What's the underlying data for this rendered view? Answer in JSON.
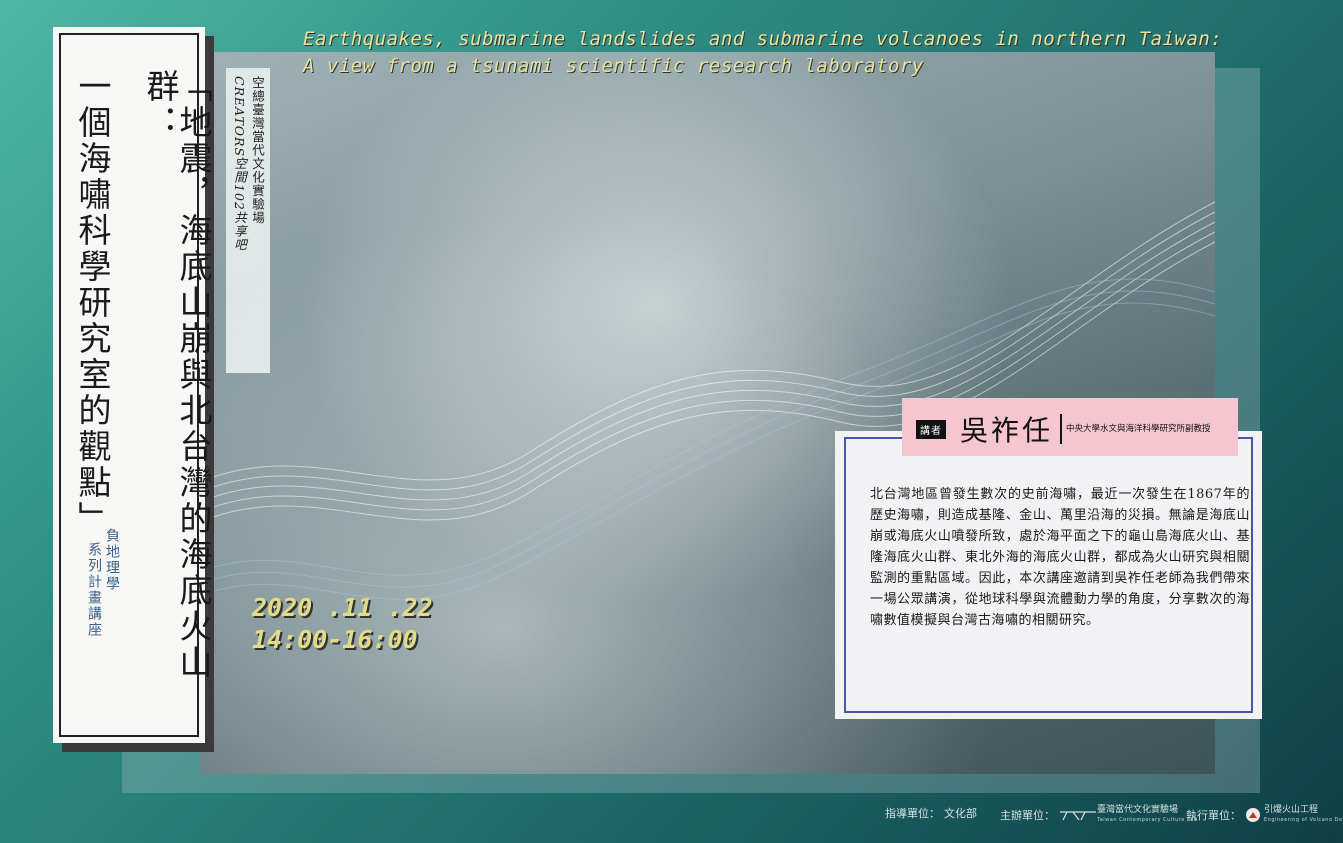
{
  "title": {
    "col1": "「地震，海底山崩與北台灣的海底火山群：",
    "col2": "一個海嘯科學研究室的觀點」"
  },
  "english_title": {
    "line1": "Earthquakes, submarine landslides and submarine volcanoes in northern Taiwan:",
    "line2": "A view from a tsunami scientific research laboratory"
  },
  "venue": {
    "line1": "空總臺灣當代文化實驗場",
    "line2": "CREATORS空間102共享吧"
  },
  "series": {
    "line1": "負地理學",
    "line2": "系列計畫講座"
  },
  "event": {
    "date": "2020 .11 .22",
    "time": "14:00-16:00"
  },
  "speaker": {
    "tag": "講者",
    "name": "吳祚任",
    "title": "中央大學水文與海洋科學研究所副教授"
  },
  "description": "北台灣地區曾發生數次的史前海嘯，最近一次發生在1867年的歷史海嘯，則造成基隆、金山、萬里沿海的災損。無論是海底山崩或海底火山噴發所致，處於海平面之下的龜山島海底火山、基隆海底火山群、東北外海的海底火山群，都成為火山研究與相關監測的重點區域。因此，本次講座邀請到吳祚任老師為我們帶來一場公眾講演，從地球科學與流體動力學的角度，分享數次的海嘯數值模擬與台灣古海嘯的相關研究。",
  "footer": {
    "advisor_label": "指導單位：",
    "advisor": "文化部",
    "host_label": "主辦單位：",
    "host": "臺灣當代文化實驗場",
    "host_sub": "Taiwan Contemporary Culture Lab",
    "exec_label": "執行單位：",
    "exec": "引爆火山工程",
    "exec_sub": "Engineering of Volcano Detonating"
  },
  "colors": {
    "bg_teal": "#2f8e85",
    "accent_yellow": "#e6e49a",
    "speaker_pink": "#f5c6cf",
    "border_blue": "#4a56a3",
    "series_blue": "#3a5f8a"
  }
}
